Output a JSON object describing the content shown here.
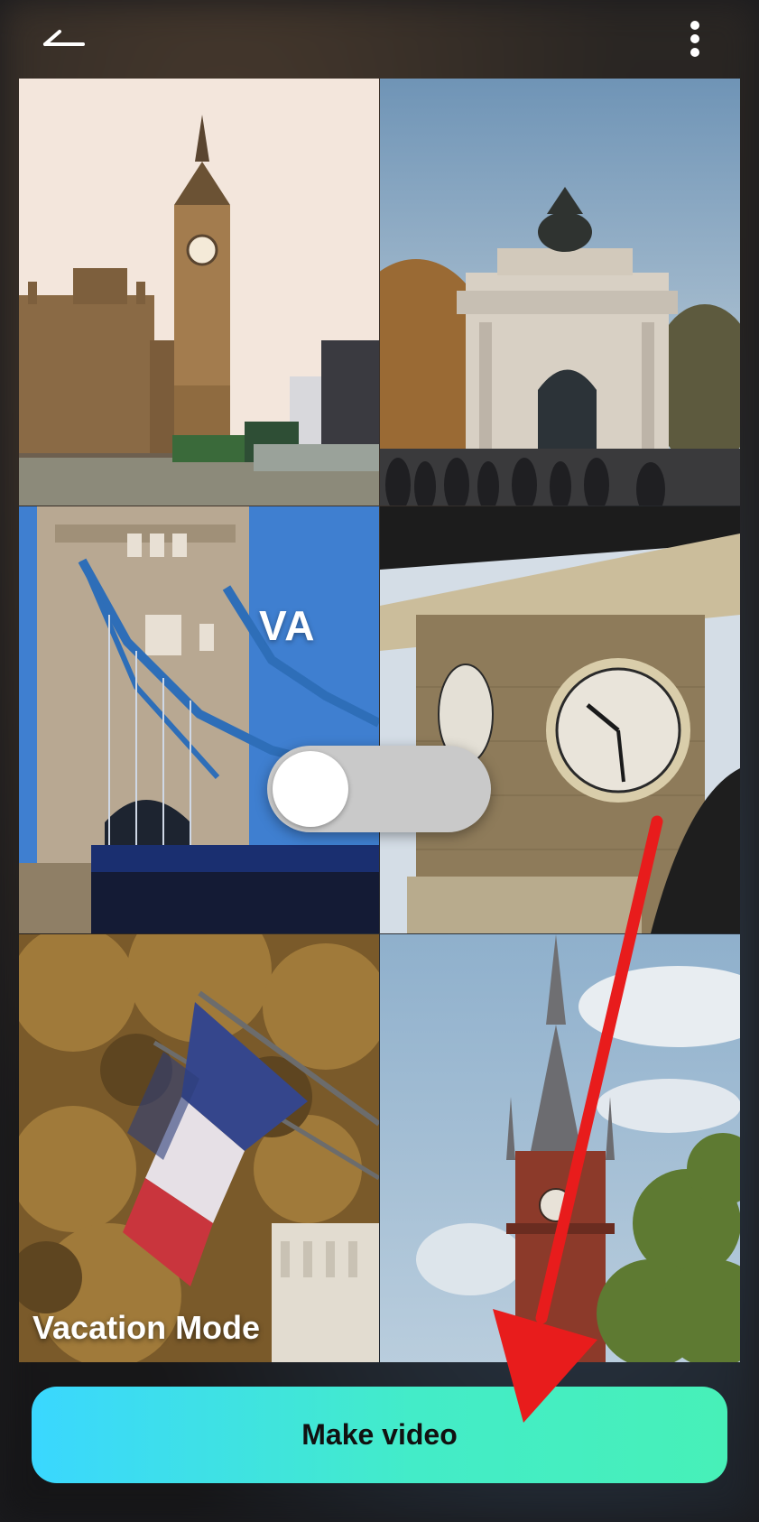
{
  "topbar": {
    "back_icon": "back-arrow-icon",
    "menu_icon": "more-vertical-icon"
  },
  "grid": {
    "tiles": [
      {
        "subject": "big-ben"
      },
      {
        "subject": "wellington-arch"
      },
      {
        "subject": "tower-bridge"
      },
      {
        "subject": "clock-tower"
      },
      {
        "subject": "french-flag"
      },
      {
        "subject": "brick-spire"
      }
    ]
  },
  "overlay": {
    "va_text": "VA",
    "toggle_state": "off"
  },
  "mode_label": "Vacation Mode",
  "make_video_label": "Make video",
  "colors": {
    "button_gradient_start": "#3ad7ff",
    "button_gradient_end": "#47f0b8",
    "annotation_arrow": "#e81c1c"
  }
}
